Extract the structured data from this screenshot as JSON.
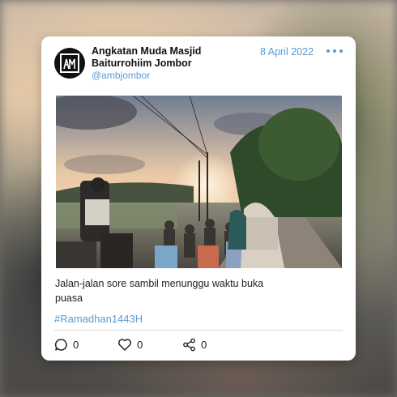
{
  "post": {
    "account_name": "Angkatan Muda Masjid Baiturrohiim Jombor",
    "handle": "@ambjombor",
    "date": "8 April 2022",
    "caption": "Jalan-jalan sore sambil menunggu waktu buka puasa",
    "hashtag": "#Ramadhan1443H",
    "avatar_logo_text": "AMB"
  },
  "actions": {
    "comments": "0",
    "likes": "0",
    "shares": "0"
  },
  "icons": [
    "more-options-icon",
    "comment-icon",
    "heart-icon",
    "share-icon"
  ],
  "colors": {
    "accent": "#5a9ad2",
    "card": "#ffffff",
    "text": "#222222"
  }
}
